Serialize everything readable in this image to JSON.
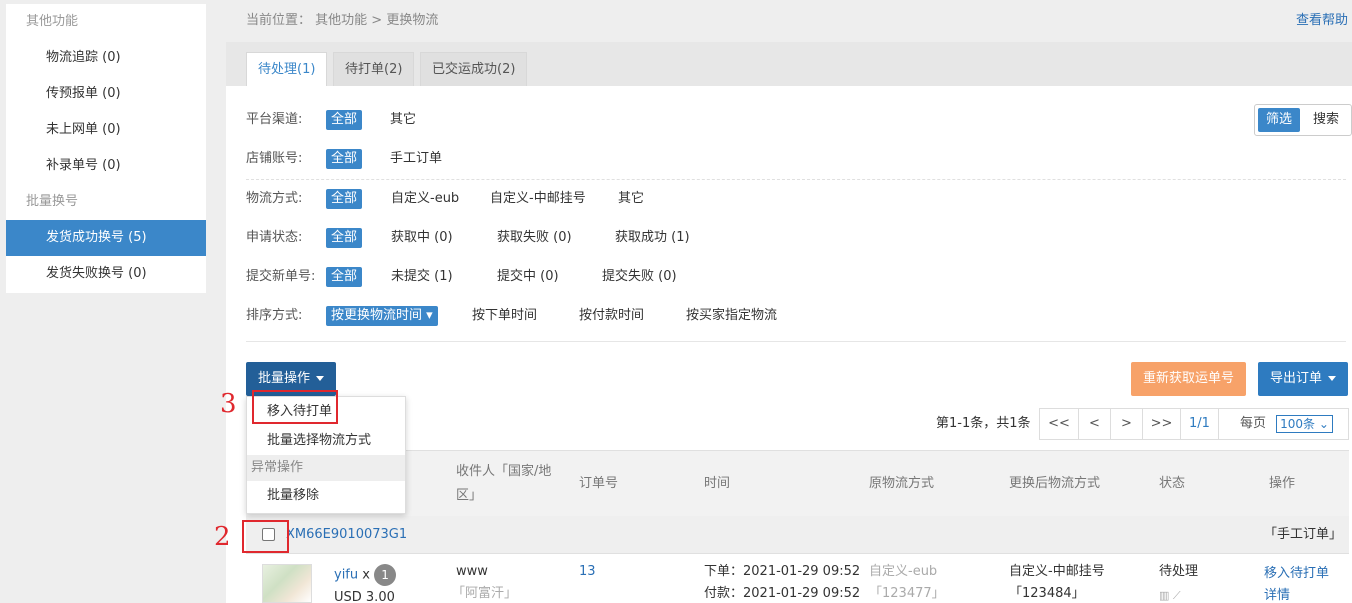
{
  "sidebar": {
    "section1": "其他功能",
    "items1": [
      {
        "label": "物流追踪 (0)"
      },
      {
        "label": "传预报单 (0)"
      },
      {
        "label": "未上网单 (0)"
      },
      {
        "label": "补录单号 (0)"
      }
    ],
    "section2": "批量换号",
    "items2": [
      {
        "label": "发货成功换号 (5)"
      },
      {
        "label": "发货失败换号 (0)"
      }
    ]
  },
  "breadcrumb": {
    "prefix": "当前位置：",
    "path": "其他功能 > 更换物流",
    "help": "查看帮助"
  },
  "tabs": [
    {
      "label": "待处理(1)"
    },
    {
      "label": "待打单(2)"
    },
    {
      "label": "已交运成功(2)"
    }
  ],
  "filters": {
    "platform": {
      "label": "平台渠道:",
      "all": "全部",
      "options": [
        "其它"
      ]
    },
    "shop": {
      "label": "店铺账号:",
      "all": "全部",
      "options": [
        "手工订单"
      ]
    },
    "logistics": {
      "label": "物流方式:",
      "all": "全部",
      "options": [
        "自定义-eub",
        "自定义-中邮挂号",
        "其它"
      ]
    },
    "status": {
      "label": "申请状态:",
      "all": "全部",
      "options": [
        "获取中 (0)",
        "获取失败 (0)",
        "获取成功 (1)"
      ]
    },
    "submit": {
      "label": "提交新单号:",
      "all": "全部",
      "options": [
        "未提交 (1)",
        "提交中 (0)",
        "提交失败 (0)"
      ]
    },
    "sort": {
      "label": "排序方式:",
      "active": "按更换物流时间 ▾",
      "options": [
        "按下单时间",
        "按付款时间",
        "按买家指定物流"
      ]
    }
  },
  "switch": {
    "filter": "筛选",
    "search": "搜索"
  },
  "toolbar": {
    "batch": "批量操作",
    "refetch": "重新获取运单号",
    "export": "导出订单"
  },
  "dropdown": {
    "move": "移入待打单",
    "select_logistics": "批量选择物流方式",
    "exception_header": "异常操作",
    "batch_remove": "批量移除"
  },
  "annotations": {
    "n2": "2",
    "n3": "3"
  },
  "pager": {
    "summary": "第1-1条，共1条",
    "first": "<<",
    "prev": "<",
    "next": ">",
    "last": ">>",
    "current": "1/1",
    "per_page_label": "每页",
    "per_page_value": "100条"
  },
  "table": {
    "headers": {
      "recipient": "收件人「国家/地区」",
      "order_no": "订单号",
      "time": "时间",
      "orig_logistics": "原物流方式",
      "new_logistics": "更换后物流方式",
      "status": "状态",
      "action": "操作"
    },
    "group": {
      "tracking": "XM66E9010073G1",
      "source": "「手工订单」"
    },
    "row": {
      "product_name": "yifu",
      "product_x": "x",
      "qty": "1",
      "price": "USD 3.00",
      "recipient_name": "www",
      "recipient_country": "「阿富汗」",
      "order_no": "13",
      "order_time": "下单：2021-01-29 09:52",
      "pay_time": "付款：2021-01-29 09:52",
      "orig_logistics": "自定义-eub",
      "orig_tracking": "「123477」",
      "new_logistics": "自定义-中邮挂号",
      "new_tracking": "「123484」",
      "status": "待处理",
      "action_move": "移入待打单",
      "action_detail": "详情"
    }
  },
  "colors": {
    "accent": "#3b87c9",
    "dark_button": "#235f98",
    "orange_button": "#f7a269",
    "annotation_red": "#e0282e"
  }
}
